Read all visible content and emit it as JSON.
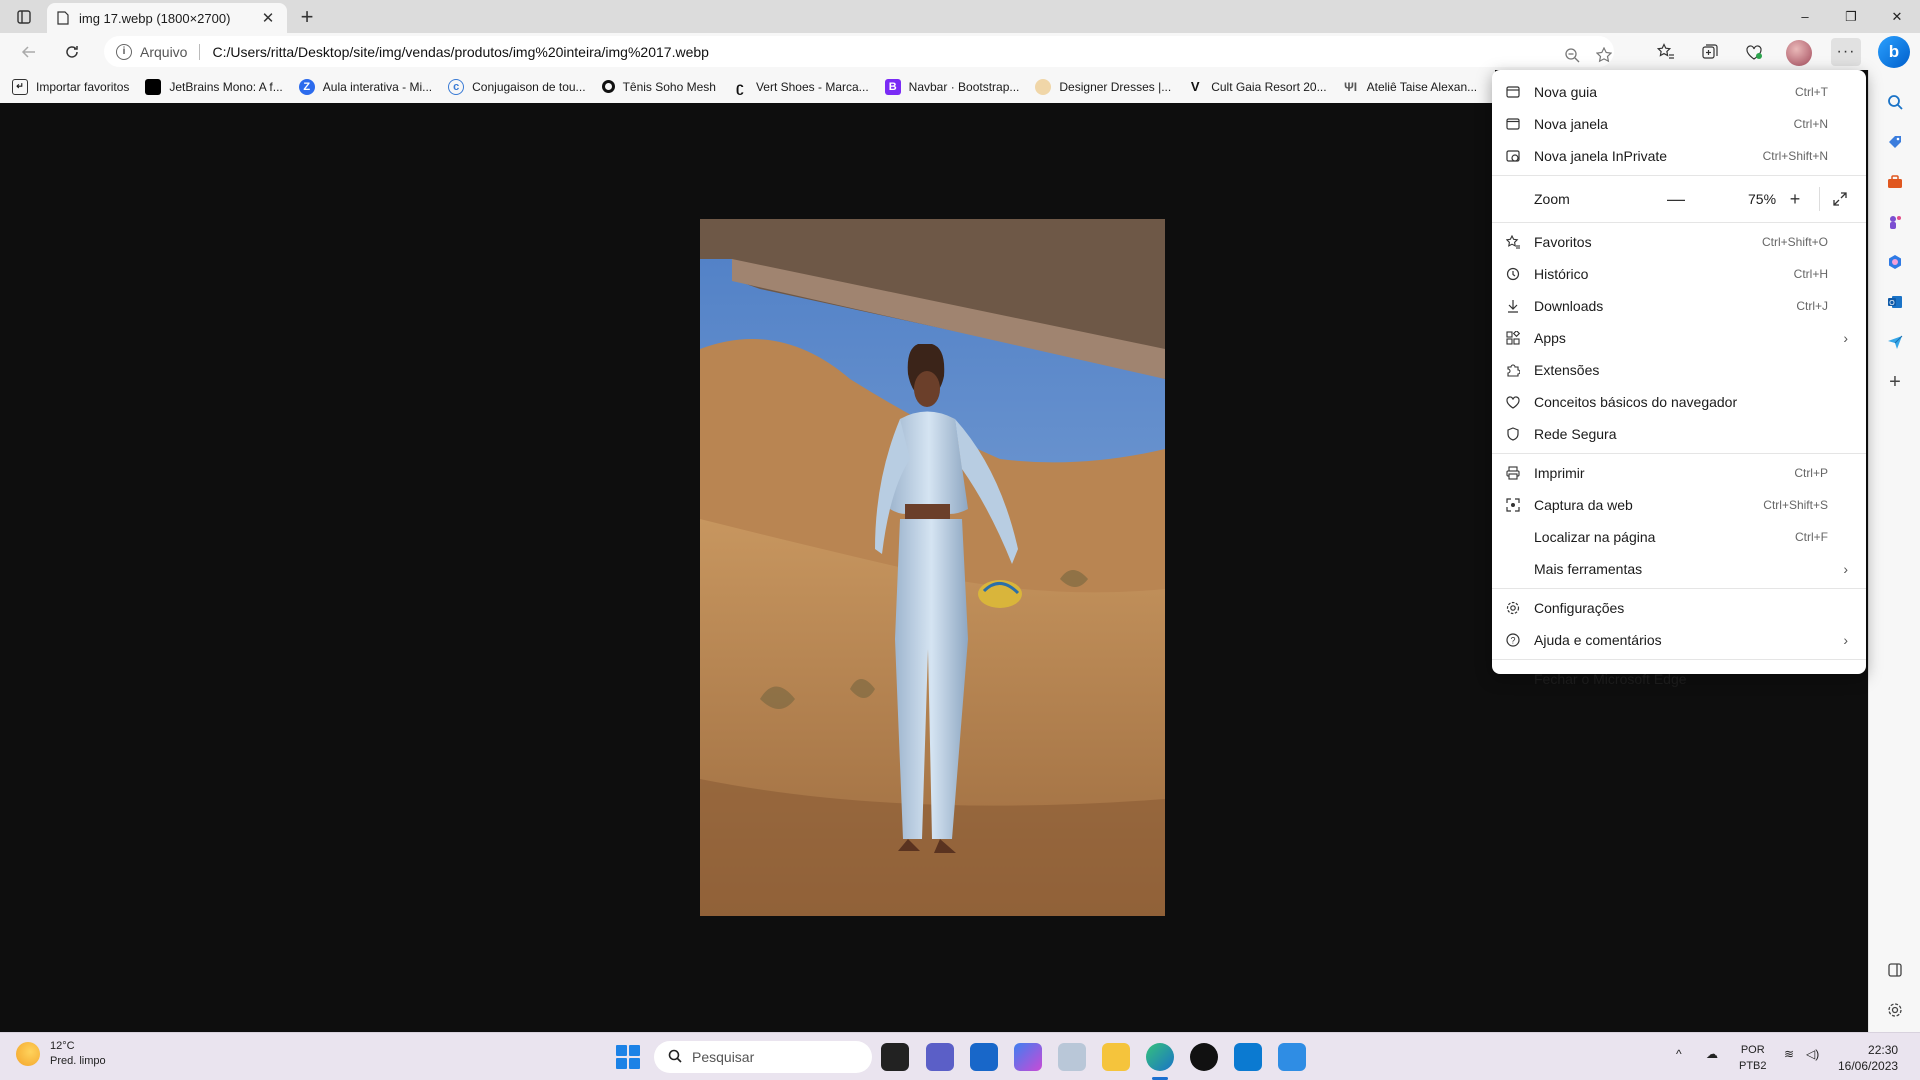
{
  "tab": {
    "title": "img 17.webp (1800×2700)",
    "close": "✕",
    "new": "+"
  },
  "window": {
    "minimize": "–",
    "restore": "❐",
    "close": "✕"
  },
  "address": {
    "scheme": "Arquivo",
    "url": "C:/Users/ritta/Desktop/site/img/vendas/produtos/img%20inteira/img%2017.webp"
  },
  "favorites": [
    {
      "label": "Importar favoritos",
      "icon": "import-icon"
    },
    {
      "label": "JetBrains Mono: A f...",
      "icon": "jetbrains-icon"
    },
    {
      "label": "Aula interativa - Mi...",
      "icon": "z-icon"
    },
    {
      "label": "Conjugaison de tou...",
      "icon": "conjugaison-icon"
    },
    {
      "label": "Tênis Soho Mesh",
      "icon": "o-icon"
    },
    {
      "label": "Vert Shoes - Marca...",
      "icon": "vert-icon"
    },
    {
      "label": "Navbar · Bootstrap...",
      "icon": "bootstrap-icon"
    },
    {
      "label": "Designer Dresses |...",
      "icon": "designer-icon"
    },
    {
      "label": "Cult Gaia Resort 20...",
      "icon": "v-icon"
    },
    {
      "label": "Ateliê Taise Alexan...",
      "icon": "fork-icon"
    }
  ],
  "menu": {
    "items_top": [
      {
        "label": "Nova guia",
        "shortcut": "Ctrl+T",
        "icon": "new-tab-icon"
      },
      {
        "label": "Nova janela",
        "shortcut": "Ctrl+N",
        "icon": "new-window-icon"
      },
      {
        "label": "Nova janela InPrivate",
        "shortcut": "Ctrl+Shift+N",
        "icon": "inprivate-icon"
      }
    ],
    "zoom": {
      "label": "Zoom",
      "value": "75%",
      "minus": "—",
      "plus": "+"
    },
    "items_mid": [
      {
        "label": "Favoritos",
        "shortcut": "Ctrl+Shift+O",
        "icon": "favorites-icon"
      },
      {
        "label": "Histórico",
        "shortcut": "Ctrl+H",
        "icon": "history-icon"
      },
      {
        "label": "Downloads",
        "shortcut": "Ctrl+J",
        "icon": "download-icon"
      },
      {
        "label": "Apps",
        "shortcut": "",
        "icon": "apps-icon",
        "submenu": true
      },
      {
        "label": "Extensões",
        "shortcut": "",
        "icon": "extensions-icon"
      },
      {
        "label": "Conceitos básicos do navegador",
        "shortcut": "",
        "icon": "essentials-icon"
      },
      {
        "label": "Rede Segura",
        "shortcut": "",
        "icon": "secure-network-icon"
      }
    ],
    "items_tools": [
      {
        "label": "Imprimir",
        "shortcut": "Ctrl+P",
        "icon": "print-icon"
      },
      {
        "label": "Captura da web",
        "shortcut": "Ctrl+Shift+S",
        "icon": "web-capture-icon"
      },
      {
        "label": "Localizar na página",
        "shortcut": "Ctrl+F",
        "icon": "find-icon"
      },
      {
        "label": "Mais ferramentas",
        "shortcut": "",
        "icon": "",
        "submenu": true
      }
    ],
    "items_bottom": [
      {
        "label": "Configurações",
        "shortcut": "",
        "icon": "settings-icon"
      },
      {
        "label": "Ajuda e comentários",
        "shortcut": "",
        "icon": "help-icon",
        "submenu": true
      }
    ],
    "close": {
      "label": "Fechar o Microsoft Edge"
    }
  },
  "taskbar": {
    "weather_temp": "12°C",
    "weather_desc": "Pred. limpo",
    "search_placeholder": "Pesquisar",
    "lang_top": "POR",
    "lang_bottom": "PTB2",
    "time": "22:30",
    "date": "16/06/2023"
  },
  "colors": {
    "accent": "#0067c0",
    "content_bg": "#0e0e0e",
    "taskbar_bg": "#eae4ef"
  }
}
